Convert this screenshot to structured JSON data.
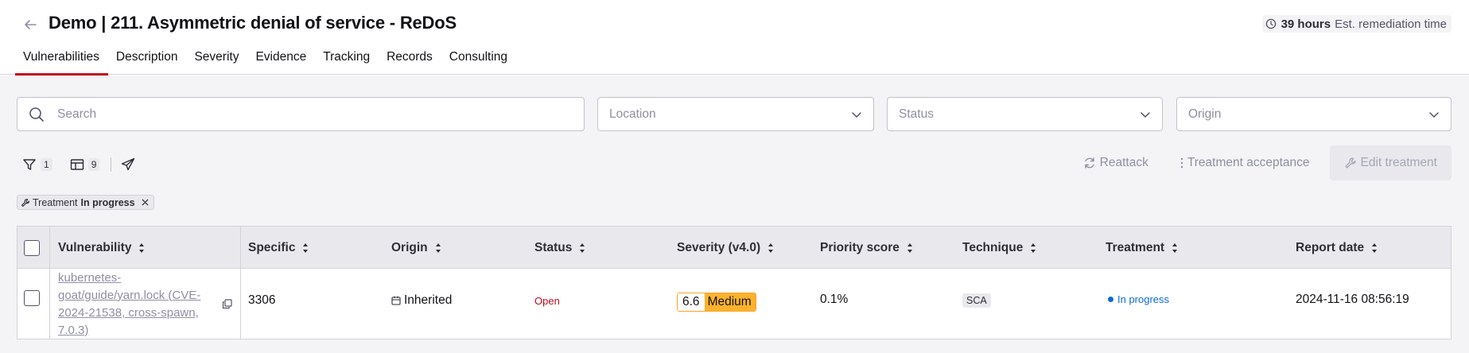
{
  "header": {
    "title": "Demo | 211. Asymmetric denial of service - ReDoS",
    "remediation_hours": "39 hours",
    "remediation_label": "Est. remediation time",
    "back_icon": "arrow-left-icon"
  },
  "tabs": [
    {
      "label": "Vulnerabilities",
      "active": true
    },
    {
      "label": "Description"
    },
    {
      "label": "Severity"
    },
    {
      "label": "Evidence"
    },
    {
      "label": "Tracking"
    },
    {
      "label": "Records"
    },
    {
      "label": "Consulting"
    }
  ],
  "filters": {
    "search_placeholder": "Search",
    "location_placeholder": "Location",
    "status_placeholder": "Status",
    "origin_placeholder": "Origin"
  },
  "toolbar": {
    "filter_count": "1",
    "columns_count": "9"
  },
  "actions": {
    "reattack": "Reattack",
    "treatment_acceptance": "Treatment acceptance",
    "edit_treatment": "Edit treatment"
  },
  "active_filter": {
    "key": "Treatment",
    "value": "In progress"
  },
  "table": {
    "columns": [
      "Vulnerability",
      "Specific",
      "Origin",
      "Status",
      "Severity (v4.0)",
      "Priority score",
      "Technique",
      "Treatment",
      "Report date"
    ],
    "rows": [
      {
        "vulnerability": "kubernetes-goat/guide/yarn.lock (CVE-2024-21538, cross-spawn, 7.0.3)",
        "specific": "3306",
        "origin": "Inherited",
        "status": "Open",
        "severity_score": "6.6",
        "severity_label": "Medium",
        "priority_score": "0.1%",
        "technique": "SCA",
        "treatment": "In progress",
        "report_date": "2024-11-16 08:56:19"
      }
    ]
  },
  "colors": {
    "accent": "#bf0b1a",
    "medium": "#fdb22c",
    "in_progress": "#0b6bd9"
  }
}
